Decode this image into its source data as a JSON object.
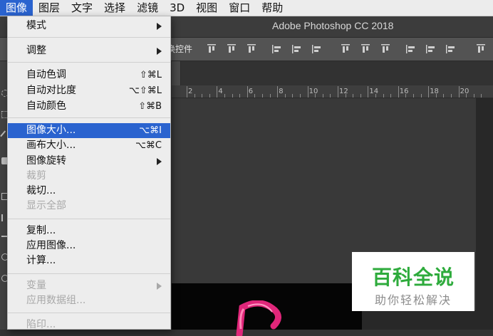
{
  "menubar": {
    "items": [
      {
        "label": "图像",
        "active": true
      },
      {
        "label": "图层"
      },
      {
        "label": "文字"
      },
      {
        "label": "选择"
      },
      {
        "label": "滤镜"
      },
      {
        "label": "3D"
      },
      {
        "label": "视图"
      },
      {
        "label": "窗口"
      },
      {
        "label": "帮助"
      }
    ]
  },
  "window": {
    "title": "Adobe Photoshop CC 2018"
  },
  "options": {
    "label": "换控件",
    "align_icons": [
      "align-top-icon",
      "align-vcenter-icon",
      "align-bottom-icon",
      "align-left-icon",
      "align-hcenter-icon",
      "align-right-icon",
      "distribute-top-icon",
      "distribute-vcenter-icon",
      "distribute-bottom-icon",
      "distribute-left-icon",
      "distribute-hcenter-icon",
      "distribute-right-icon",
      "distribute-spacing-icon"
    ]
  },
  "ruler": {
    "labels": [
      "2",
      "4",
      "6",
      "8",
      "10",
      "12",
      "14",
      "16",
      "18",
      "20"
    ]
  },
  "image_menu": {
    "items": [
      {
        "label": "模式",
        "submenu": true
      },
      {
        "label": "调整",
        "submenu": true
      },
      {
        "label": "自动色调",
        "shortcut": "⇧⌘L"
      },
      {
        "label": "自动对比度",
        "shortcut": "⌥⇧⌘L"
      },
      {
        "label": "自动颜色",
        "shortcut": "⇧⌘B"
      },
      {
        "label": "图像大小...",
        "shortcut": "⌥⌘I",
        "highlighted": true
      },
      {
        "label": "画布大小...",
        "shortcut": "⌥⌘C"
      },
      {
        "label": "图像旋转",
        "submenu": true
      },
      {
        "label": "裁剪",
        "disabled": true
      },
      {
        "label": "裁切..."
      },
      {
        "label": "显示全部",
        "disabled": true
      },
      {
        "label": "复制..."
      },
      {
        "label": "应用图像..."
      },
      {
        "label": "计算..."
      },
      {
        "label": "变量",
        "submenu": true,
        "disabled": true
      },
      {
        "label": "应用数据组...",
        "disabled": true
      },
      {
        "label": "陷印...",
        "disabled": true
      }
    ]
  },
  "watermark": {
    "title": "百科全说",
    "subtitle": "助你轻松解决"
  },
  "colors": {
    "highlight": "#2a63cf",
    "watermark_green": "#2eab3c"
  }
}
